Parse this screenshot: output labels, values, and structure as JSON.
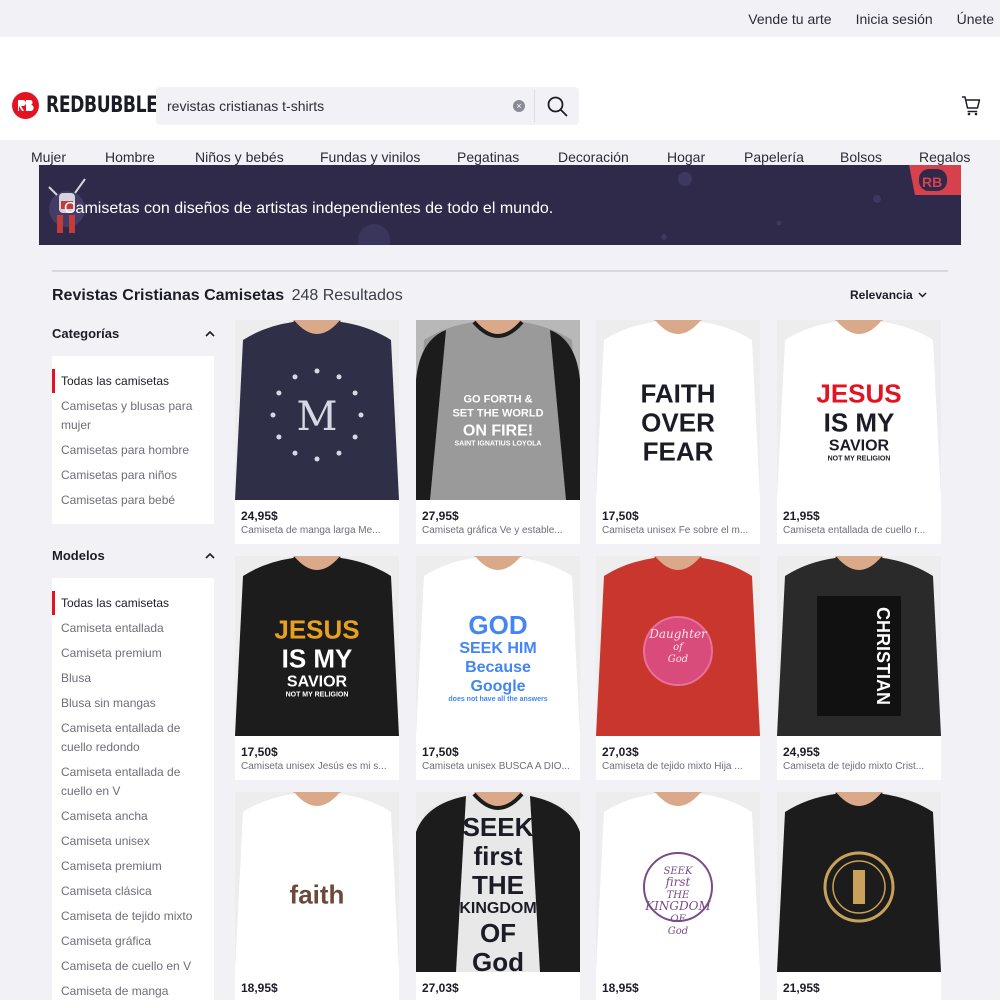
{
  "topbar": {
    "links": [
      "Vende tu arte",
      "Inicia sesión",
      "Únete"
    ]
  },
  "brand": {
    "name": "REDBUBBLE",
    "color": "#e41321"
  },
  "search": {
    "value": "revistas cristianas t-shirts",
    "icon": "search-icon"
  },
  "cart": {
    "icon": "cart-icon"
  },
  "nav": {
    "items": [
      "Mujer",
      "Hombre",
      "Niños y bebés",
      "Fundas y vinilos",
      "Pegatinas",
      "Decoración",
      "Hogar",
      "Papelería",
      "Bolsos",
      "Regalos"
    ]
  },
  "banner": {
    "text": "Camisetas con diseños de artistas independientes de todo el mundo."
  },
  "results": {
    "title": "Revistas Cristianas Camisetas",
    "count": "248 Resultados",
    "sort": "Relevancia"
  },
  "sidebar": {
    "categories": {
      "heading": "Categorías",
      "items": [
        "Todas las camisetas",
        "Camisetas y blusas para mujer",
        "Camisetas para hombre",
        "Camisetas para niños",
        "Camisetas para bebé"
      ],
      "active": 0
    },
    "models": {
      "heading": "Modelos",
      "items": [
        "Todas las camisetas",
        "Camiseta entallada",
        "Camiseta premium",
        "Blusa",
        "Blusa sin mangas",
        "Camiseta entallada de cuello redondo",
        "Camiseta entallada de cuello en V",
        "Camiseta ancha",
        "Camiseta unisex",
        "Camiseta premium",
        "Camiseta clásica",
        "Camiseta de tejido mixto",
        "Camiseta gráfica",
        "Camiseta de cuello en V",
        "Camiseta de manga"
      ],
      "active": 0
    }
  },
  "products": [
    {
      "price": "24,95$",
      "title": "Camiseta de manga larga Me...",
      "design": [
        "M"
      ],
      "shirt": "#2f2f48",
      "accent": "#d8d8e4"
    },
    {
      "price": "27,95$",
      "title": "Camiseta gráfica Ve y estable...",
      "design": [
        "GO FORTH &",
        "SET THE WORLD",
        "ON FIRE!",
        "SAINT IGNATIUS LOYOLA"
      ],
      "shirt": "#9a9a9a",
      "accent": "#ffffff"
    },
    {
      "price": "17,50$",
      "title": "Camiseta unisex Fe sobre el m...",
      "design": [
        "FAITH",
        "OVER",
        "FEAR"
      ],
      "shirt": "#ffffff",
      "accent": "#1c1c26"
    },
    {
      "price": "21,95$",
      "title": "Camiseta entallada de cuello r...",
      "design": [
        "JESUS",
        "IS MY",
        "SAVIOR",
        "NOT MY RELIGION"
      ],
      "shirt": "#ffffff",
      "accent": "#e41321"
    },
    {
      "price": "17,50$",
      "title": "Camiseta unisex Jesús es mi s...",
      "design": [
        "JESUS",
        "IS MY",
        "SAVIOR",
        "NOT MY RELIGION"
      ],
      "shirt": "#1c1c1c",
      "accent": "#e8a020"
    },
    {
      "price": "17,50$",
      "title": "Camiseta unisex BUSCA A DIO...",
      "design": [
        "GOD",
        "SEEK HIM",
        "Because",
        "Google",
        "does not have all the answers"
      ],
      "shirt": "#ffffff",
      "accent": "#4285f4"
    },
    {
      "price": "27,03$",
      "title": "Camiseta de tejido mixto Hija ...",
      "design": [
        "Daughter",
        "of",
        "God"
      ],
      "shirt": "#c8362e",
      "accent": "#e8709a"
    },
    {
      "price": "24,95$",
      "title": "Camiseta de tejido mixto Crist...",
      "design": [
        "CHRISTIAN"
      ],
      "shirt": "#2a2a2a",
      "accent": "#ffffff"
    },
    {
      "price": "18,95$",
      "title": "",
      "design": [
        "faith"
      ],
      "shirt": "#ffffff",
      "accent": "#6b4a3a"
    },
    {
      "price": "27,03$",
      "title": "",
      "design": [
        "SEEK",
        "first",
        "THE",
        "KINGDOM",
        "OF",
        "God"
      ],
      "shirt": "#e8e8e8",
      "accent": "#1c1c26"
    },
    {
      "price": "18,95$",
      "title": "",
      "design": [
        "SEEK",
        "first",
        "THE",
        "KINGDOM",
        "OF",
        "God"
      ],
      "shirt": "#ffffff",
      "accent": "#7a4a8a"
    },
    {
      "price": "21,95$",
      "title": "",
      "design": [],
      "shirt": "#1c1c1c",
      "accent": "#c9a15a"
    }
  ]
}
